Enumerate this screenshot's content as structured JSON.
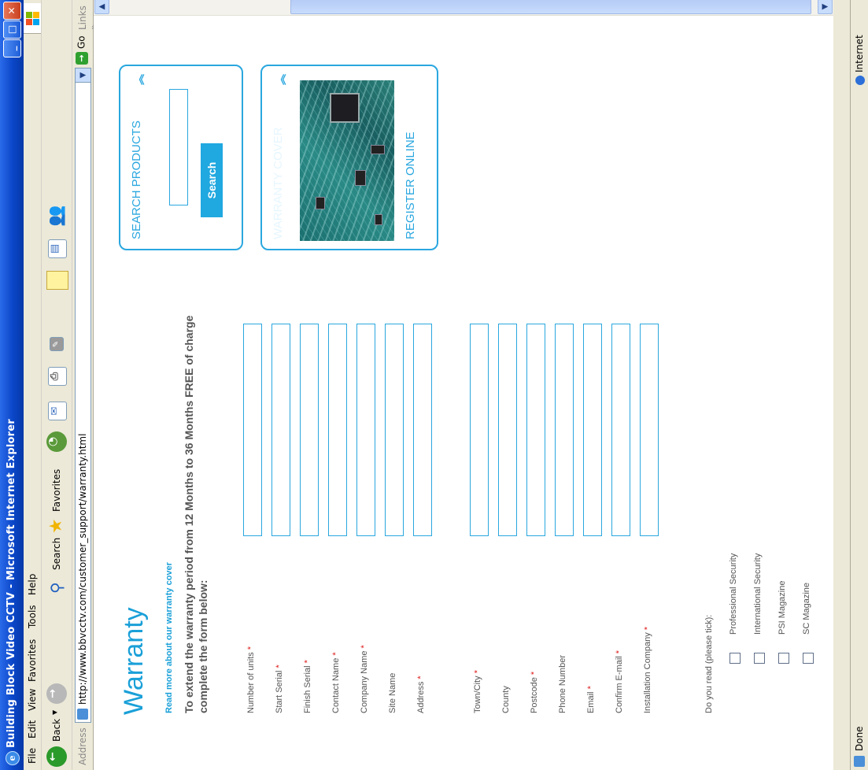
{
  "window": {
    "title": "Building Block Video CCTV - Microsoft Internet Explorer",
    "minimize": "_",
    "maximize": "□",
    "close": "✕"
  },
  "menu": [
    "File",
    "Edit",
    "View",
    "Favorites",
    "Tools",
    "Help"
  ],
  "toolbar": {
    "back_label": "Back",
    "search_label": "Search",
    "favorites_label": "Favorites"
  },
  "address": {
    "label": "Address",
    "url": "http://www.bbvcctv.com/customer_support/warranty.html",
    "go_label": "Go",
    "links_label": "Links"
  },
  "page": {
    "title": "Warranty",
    "read_more": "Read more about our warranty cover",
    "intro": "To extend the warranty period from 12 Months to 36 Months FREE of charge complete the form below:",
    "fields": [
      {
        "label": "Number of units",
        "required": "*"
      },
      {
        "label": "Start Serial",
        "required": "*"
      },
      {
        "label": "Finish Serial",
        "required": "*"
      },
      {
        "label": "Contact Name",
        "required": "*"
      },
      {
        "label": "Company Name",
        "required": "*"
      },
      {
        "label": "Site Name",
        "required": ""
      },
      {
        "label": "Address",
        "required": "*"
      },
      {
        "label": "Town/City",
        "required": "*"
      },
      {
        "label": "County",
        "required": ""
      },
      {
        "label": "Postcode",
        "required": "*"
      },
      {
        "label": "Phone Number",
        "required": ""
      },
      {
        "label": "Email",
        "required": "*"
      },
      {
        "label": "Confirm E-mail",
        "required": "*"
      },
      {
        "label": "Installation Company",
        "required": "*"
      }
    ],
    "do_you_read": "Do you read (please tick):",
    "magazines": [
      "Professional Security",
      "International Security",
      "PSI Magazine",
      "SC Magazine"
    ]
  },
  "sidebar": {
    "search_heading": "SEARCH PRODUCTS",
    "search_button": "Search",
    "warranty_heading": "WARRANTY COVER",
    "register_online": "REGISTER ONLINE",
    "chevron": "︽"
  },
  "status": {
    "text": "Done",
    "zone": "Internet"
  },
  "colors": {
    "accent": "#2aa7df",
    "required": "#e02020",
    "titlebar": "#0a46c8"
  }
}
